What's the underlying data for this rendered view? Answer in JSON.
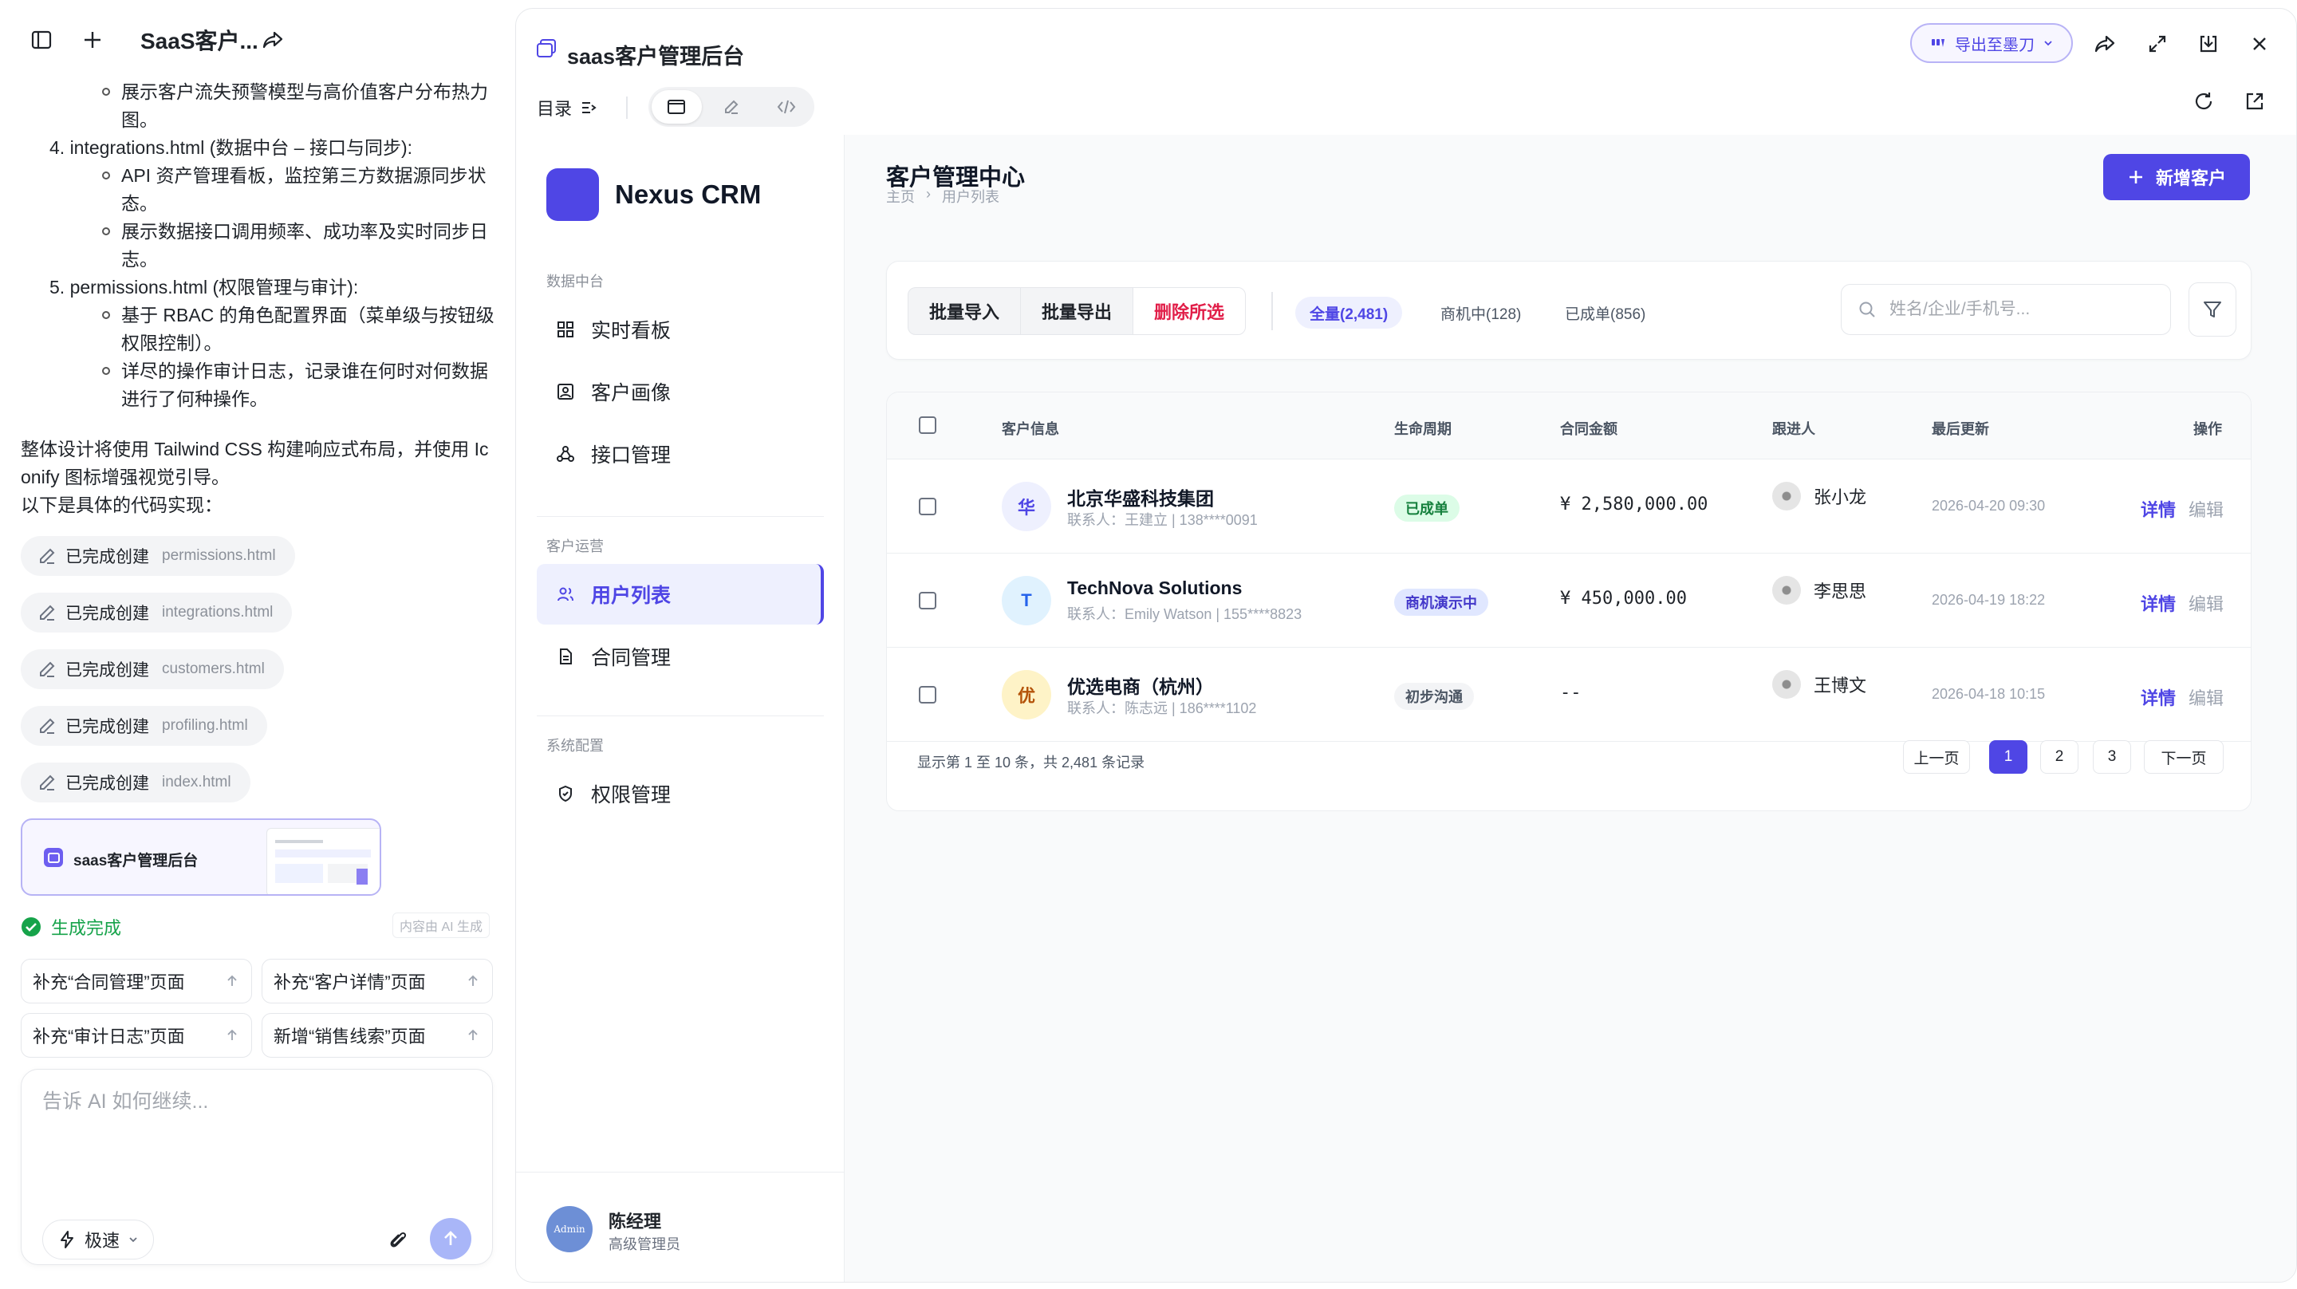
{
  "chat": {
    "title": "SaaS客户...",
    "lines": [
      "展示客户流失预警模型与高价值客户分布热力",
      "图。",
      "4. integrations.html (数据中台 – 接口与同步):",
      "API 资产管理看板，监控第三方数据源同步状",
      "态。",
      "展示数据接口调用频率、成功率及实时同步日",
      "志。",
      "5. permissions.html (权限管理与审计):",
      "基于 RBAC 的角色配置界面（菜单级与按钮级",
      "权限控制）。",
      "详尽的操作审计日志，记录谁在何时对何数据",
      "进行了何种操作。",
      "整体设计将使用 Tailwind CSS 构建响应式布局，并使用 Ic",
      "onify 图标增强视觉引导。",
      "以下是具体的代码实现："
    ],
    "completed_label": "已完成创建",
    "completed_files": [
      "permissions.html",
      "integrations.html",
      "customers.html",
      "profiling.html",
      "index.html"
    ],
    "artifact_title": "saas客户管理后台",
    "generation_status": "生成完成",
    "ai_note": "内容由 AI 生成",
    "suggestions": [
      "补充“合同管理”页面",
      "补充“客户详情”页面",
      "补充“审计日志”页面",
      "新增“销售线索”页面"
    ],
    "composer_placeholder": "告诉 AI 如何继续...",
    "mode_label": "极速"
  },
  "preview": {
    "title": "saas客户管理后台",
    "export_label": "导出至墨刀",
    "toc_label": "目录"
  },
  "crm": {
    "brand": "Nexus CRM",
    "nav_groups": [
      {
        "title": "数据中台",
        "items": [
          "实时看板",
          "客户画像",
          "接口管理"
        ]
      },
      {
        "title": "客户运营",
        "items": [
          "用户列表",
          "合同管理"
        ]
      },
      {
        "title": "系统配置",
        "items": [
          "权限管理"
        ]
      }
    ],
    "active_nav": "用户列表",
    "user": {
      "avatar_text": "Admin",
      "name": "陈经理",
      "role": "高级管理员"
    },
    "page_title": "客户管理中心",
    "breadcrumb": [
      "主页",
      "›",
      "用户列表"
    ],
    "add_button": "新增客户",
    "bulk_actions": [
      "批量导入",
      "批量导出",
      "删除所选"
    ],
    "filters": [
      "全量(2,481)",
      "商机中(128)",
      "已成单(856)"
    ],
    "search_placeholder": "姓名/企业/手机号...",
    "columns": [
      "客户信息",
      "生命周期",
      "合同金额",
      "跟进人",
      "最后更新",
      "操作"
    ],
    "rows": [
      {
        "avatar": "华",
        "name": "北京华盛科技集团",
        "contact": "联系人：王建立 | 138****0091",
        "stage": "已成单",
        "amount": "¥ 2,580,000.00",
        "owner": "张小龙",
        "updated": "2026-04-20 09:30",
        "detail": "详情",
        "edit": "编辑"
      },
      {
        "avatar": "T",
        "name": "TechNova Solutions",
        "contact": "联系人：Emily Watson | 155****8823",
        "stage": "商机演示中",
        "amount": "¥ 450,000.00",
        "owner": "李思思",
        "updated": "2026-04-19 18:22",
        "detail": "详情",
        "edit": "编辑"
      },
      {
        "avatar": "优",
        "name": "优选电商（杭州）",
        "contact": "联系人：陈志远 | 186****1102",
        "stage": "初步沟通",
        "amount": "--",
        "owner": "王博文",
        "updated": "2026-04-18 10:15",
        "detail": "详情",
        "edit": "编辑"
      }
    ],
    "pager_info": "显示第 1 至 10 条，共 2,481 条记录",
    "pager": {
      "prev": "上一页",
      "pages": [
        "1",
        "2",
        "3"
      ],
      "next": "下一页"
    }
  },
  "colors": {
    "accent": "#4f46e5",
    "success": "#16a34a",
    "danger": "#e11d48",
    "stage_won_bg": "#dcfce7",
    "stage_opportunity_bg": "#e0e7ff",
    "stage_initial_bg": "#f3f4f6"
  }
}
